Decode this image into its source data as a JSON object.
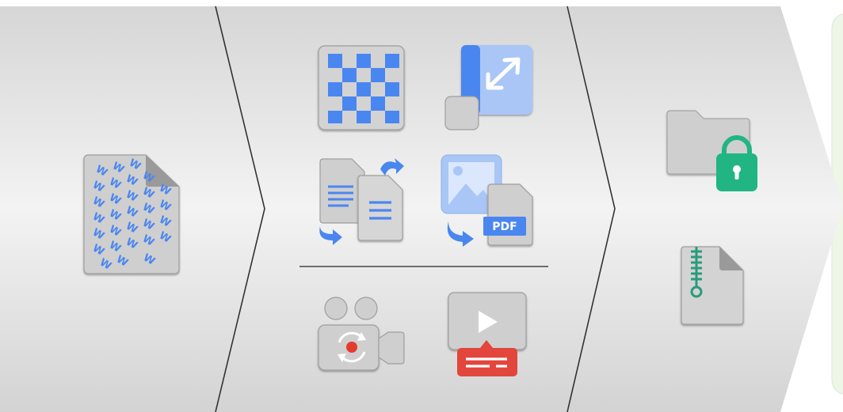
{
  "diagram": {
    "stages": [
      {
        "id": "source",
        "icons": [
          "watermarked-document-icon"
        ]
      },
      {
        "id": "processing",
        "upper_icons": [
          "checkerboard-watermark-icon",
          "resize-page-icon",
          "convert-document-icon",
          "image-to-pdf-icon"
        ],
        "lower_icons": [
          "video-camera-record-icon",
          "video-subtitle-icon"
        ]
      },
      {
        "id": "output",
        "icons": [
          "locked-folder-icon",
          "zip-file-icon"
        ]
      }
    ],
    "labels": {
      "pdf_badge": "PDF"
    },
    "colors": {
      "accent_blue": "#4a86f0",
      "light_blue": "#a9c6f7",
      "icon_gray": "#cfcfcf",
      "icon_border": "#9e9e9e",
      "lock_green": "#21b583",
      "zip_green": "#2a9b7b",
      "subtitle_red": "#e2463c",
      "record_red": "#e53a2f",
      "output_panel_green": "#eef6e8"
    }
  }
}
